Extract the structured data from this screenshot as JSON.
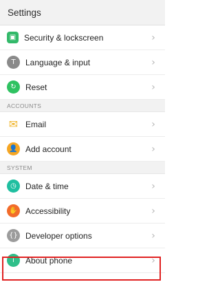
{
  "header": {
    "title": "Settings"
  },
  "sections": {
    "top": [
      {
        "label": "Security & lockscreen",
        "icon": "lock-icon"
      },
      {
        "label": "Language & input",
        "icon": "language-icon"
      },
      {
        "label": "Reset",
        "icon": "reset-icon"
      }
    ],
    "accounts_header": "ACCOUNTS",
    "accounts": [
      {
        "label": "Email",
        "icon": "email-icon"
      },
      {
        "label": "Add account",
        "icon": "add-account-icon"
      }
    ],
    "system_header": "SYSTEM",
    "system": [
      {
        "label": "Date & time",
        "icon": "clock-icon"
      },
      {
        "label": "Accessibility",
        "icon": "accessibility-icon"
      },
      {
        "label": "Developer options",
        "icon": "developer-icon"
      },
      {
        "label": "About phone",
        "icon": "info-icon"
      }
    ]
  },
  "colors": {
    "highlight": "#e02020"
  }
}
